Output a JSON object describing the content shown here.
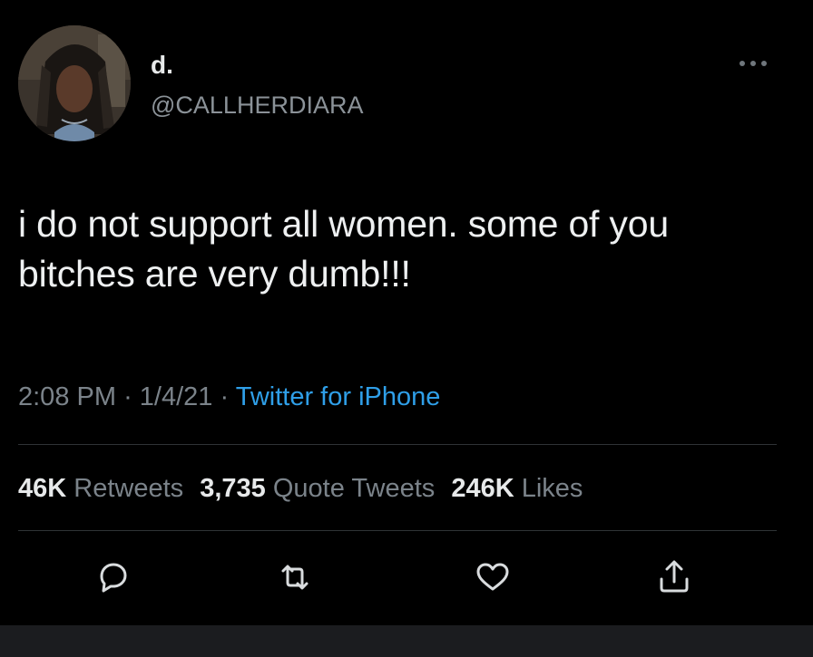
{
  "user": {
    "display_name": "d.",
    "handle": "@CALLHERDIARA",
    "avatar_icon": "user-avatar"
  },
  "tweet": {
    "text": "i do not support all women. some of you bitches are very dumb!!!",
    "time": "2:08 PM",
    "date": "1/4/21",
    "separator": "·",
    "source": "Twitter for iPhone"
  },
  "stats": {
    "retweets_count": "46K",
    "retweets_label": "Retweets",
    "quotes_count": "3,735",
    "quotes_label": "Quote Tweets",
    "likes_count": "246K",
    "likes_label": "Likes"
  },
  "actions": [
    "reply-icon",
    "retweet-icon",
    "like-icon",
    "share-icon"
  ],
  "colors": {
    "background": "#000000",
    "text": "#e7e9ea",
    "secondary": "#7b838a",
    "link": "#2f9fe8",
    "divider": "#2f3336"
  }
}
